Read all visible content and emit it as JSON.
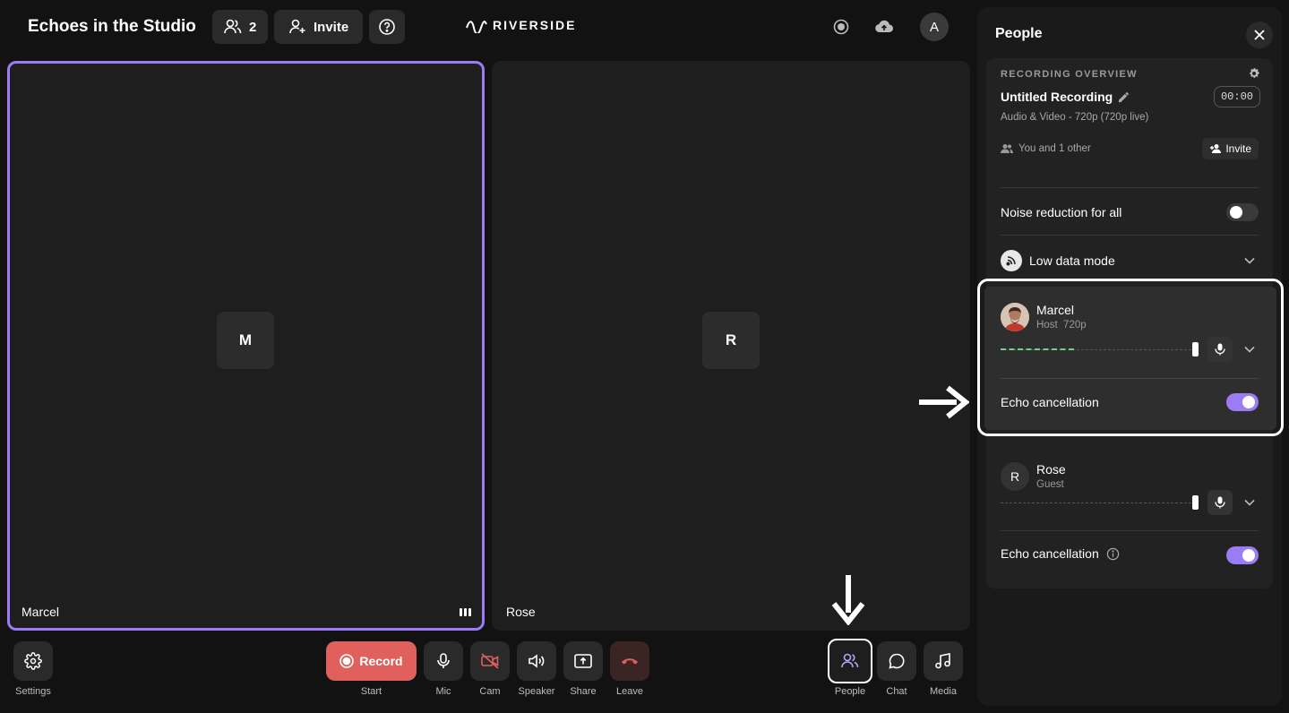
{
  "header": {
    "title": "Echoes in the Studio",
    "participants_count": "2",
    "invite_label": "Invite",
    "logo_text": "RIVERSIDE",
    "avatar_initial": "A"
  },
  "tiles": [
    {
      "initial": "M",
      "name": "Marcel",
      "active": true
    },
    {
      "initial": "R",
      "name": "Rose",
      "active": false
    }
  ],
  "controls": {
    "settings": "Settings",
    "record_button": "Record",
    "record_caption": "Start",
    "mic": "Mic",
    "cam": "Cam",
    "speaker": "Speaker",
    "share": "Share",
    "leave": "Leave",
    "people": "People",
    "chat": "Chat",
    "media": "Media"
  },
  "panel": {
    "title": "People",
    "overview": {
      "heading": "RECORDING OVERVIEW",
      "recording_title": "Untitled Recording",
      "timer": "00:00",
      "quality": "Audio & Video - 720p (720p live)",
      "participants": "You and 1 other",
      "invite_label": "Invite"
    },
    "noise_reduction_label": "Noise reduction for all",
    "noise_reduction_on": false,
    "low_data_mode_label": "Low data mode",
    "people": [
      {
        "name": "Marcel",
        "role": "Host",
        "quality": "720p",
        "echo_label": "Echo cancellation",
        "echo_on": true
      },
      {
        "name": "Rose",
        "role": "Guest",
        "initial": "R",
        "echo_label": "Echo cancellation",
        "echo_on": true
      }
    ]
  },
  "colors": {
    "accent": "#9b7cf4",
    "record": "#e0605e",
    "leave_icon": "#e0605e",
    "level_meter": "#6fd08a"
  }
}
